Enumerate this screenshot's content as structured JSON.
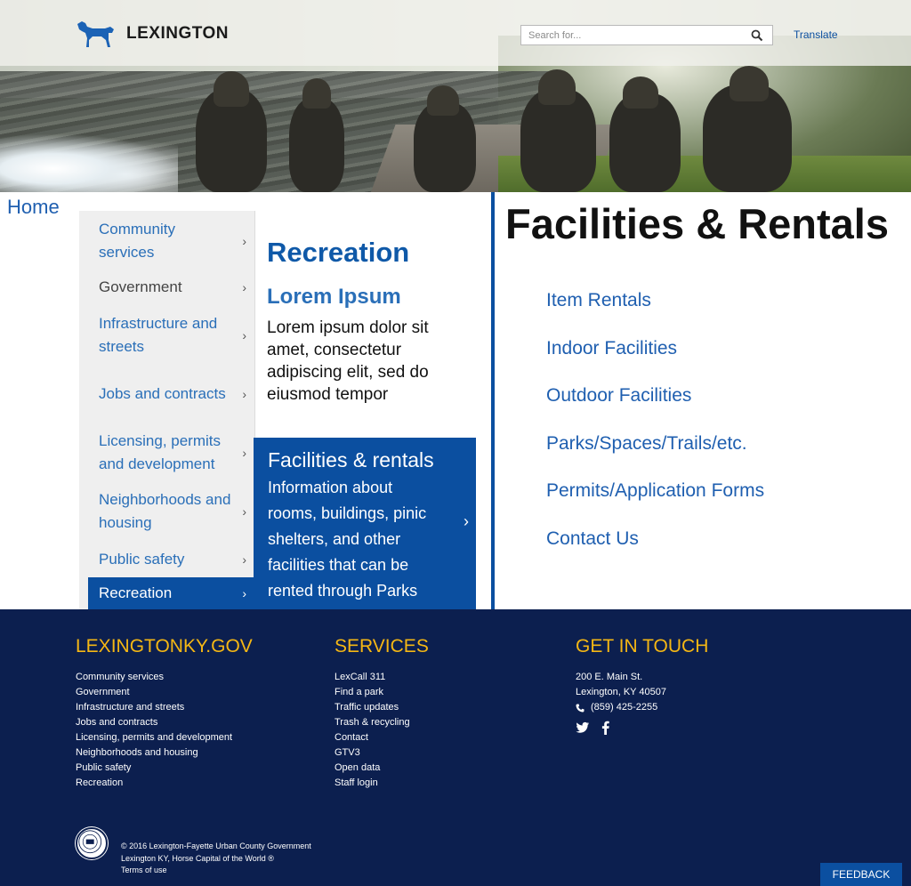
{
  "header": {
    "logo_text": "LEXINGTON",
    "search_placeholder": "Search for...",
    "translate_label": "Translate"
  },
  "breadcrumb": {
    "home_label": "Home"
  },
  "subnav": {
    "items": [
      {
        "label": "Community services",
        "active": false
      },
      {
        "label": "Government",
        "active": false
      },
      {
        "label": "Infrastructure and streets",
        "active": false
      },
      {
        "label": "Jobs and contracts",
        "active": false
      },
      {
        "label": "Licensing, permits and development",
        "active": false
      },
      {
        "label": "Neighborhoods and housing",
        "active": false
      },
      {
        "label": "Public safety",
        "active": false
      },
      {
        "label": "Recreation",
        "active": true
      }
    ]
  },
  "section": {
    "title": "Recreation",
    "lorem_title": "Lorem Ipsum",
    "lorem_body": "Lorem ipsum dolor sit amet, consectetur adipiscing elit, sed do eiusmod tempor",
    "feature_title": "Facilities & rentals",
    "feature_desc": "Information about rooms, buildings, pinic shelters, and other facilities that can be rented through Parks"
  },
  "page": {
    "title": "Facilities & Rentals",
    "links": [
      "Item Rentals",
      "Indoor Facilities",
      "Outdoor Facilities",
      "Parks/Spaces/Trails/etc.",
      "Permits/Application Forms",
      "Contact Us"
    ]
  },
  "footer": {
    "col1_heading": "LEXINGTONKY.GOV",
    "col1_links": [
      "Community services",
      "Government",
      "Infrastructure and streets",
      "Jobs and contracts",
      "Licensing, permits and development",
      "Neighborhoods and housing",
      "Public safety",
      "Recreation"
    ],
    "col2_heading": "SERVICES",
    "col2_links": [
      "LexCall 311",
      "Find a park",
      "Traffic updates",
      "Trash & recycling",
      "Contact",
      "GTV3",
      "Open data",
      "Staff login"
    ],
    "col3_heading": "GET IN TOUCH",
    "address_line1": "200 E. Main St.",
    "address_line2": "Lexington, KY 40507",
    "phone": "(859) 425-2255",
    "copyright": "© 2016 Lexington-Fayette Urban County Government",
    "tagline": "Lexington KY, Horse Capital of the World",
    "terms": "Terms of use",
    "feedback_label": "FEEDBACK"
  },
  "colors": {
    "brand_blue": "#0b4fa0",
    "footer_navy": "#0c1f4f",
    "footer_heading_gold": "#f5b714",
    "link_blue": "#1f5fb0"
  }
}
